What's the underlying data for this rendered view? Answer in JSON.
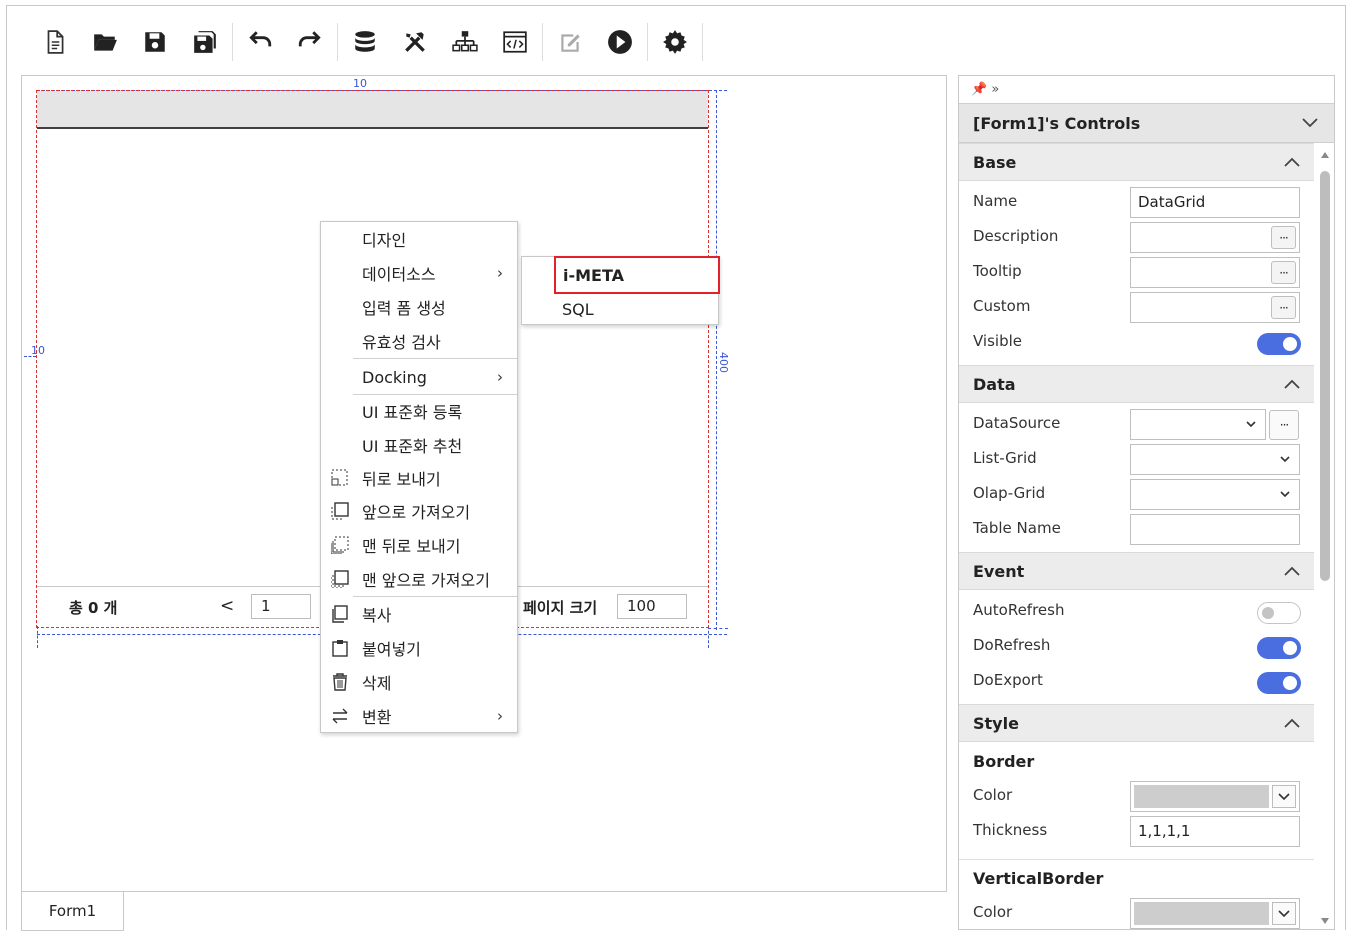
{
  "toolbar": {
    "icons": [
      "new-file-icon",
      "open-folder-icon",
      "save-icon",
      "save-all-icon",
      "undo-icon",
      "redo-icon",
      "database-icon",
      "tools-icon",
      "hierarchy-icon",
      "code-view-icon",
      "edit-icon",
      "run-icon",
      "settings-icon"
    ]
  },
  "designer": {
    "ruler_top": "10",
    "ruler_left": "10",
    "ruler_right": "400",
    "form_tab": "Form1",
    "grid_footer": {
      "total_label": "총  0 개",
      "prev": "<",
      "page_value": "1",
      "page_size_label": "페이지 크기",
      "page_size_value": "100"
    }
  },
  "context_menu": {
    "items": [
      {
        "label": "디자인",
        "arrow": ""
      },
      {
        "label": "데이터소스",
        "arrow": "›"
      },
      {
        "label": "입력 폼 생성",
        "arrow": ""
      },
      {
        "label": "유효성 검사",
        "arrow": ""
      },
      {
        "label": "Docking",
        "arrow": "›"
      },
      {
        "label": "UI 표준화 등록",
        "arrow": ""
      },
      {
        "label": "UI 표준화 추천",
        "arrow": ""
      },
      {
        "label": "뒤로 보내기",
        "arrow": ""
      },
      {
        "label": "앞으로 가져오기",
        "arrow": ""
      },
      {
        "label": "맨 뒤로 보내기",
        "arrow": ""
      },
      {
        "label": "맨 앞으로 가져오기",
        "arrow": ""
      },
      {
        "label": "복사",
        "arrow": ""
      },
      {
        "label": "붙여넣기",
        "arrow": ""
      },
      {
        "label": "삭제",
        "arrow": ""
      },
      {
        "label": "변환",
        "arrow": "›"
      }
    ],
    "submenu": [
      "i-META",
      "SQL"
    ]
  },
  "panel": {
    "top_icons": "📌 »",
    "title": "[Form1]'s Controls",
    "sections": {
      "base": "Base",
      "data": "Data",
      "event": "Event",
      "style": "Style"
    },
    "base": {
      "name_label": "Name",
      "name_value": "DataGrid",
      "description_label": "Description",
      "tooltip_label": "Tooltip",
      "custom_label": "Custom",
      "visible_label": "Visible"
    },
    "data": {
      "datasource_label": "DataSource",
      "listgrid_label": "List-Grid",
      "olapgrid_label": "Olap-Grid",
      "tablename_label": "Table Name"
    },
    "event": {
      "autorefresh_label": "AutoRefresh",
      "dorefresh_label": "DoRefresh",
      "doexport_label": "DoExport"
    },
    "style": {
      "border_head": "Border",
      "color_label": "Color",
      "thickness_label": "Thickness",
      "thickness_value": "1,1,1,1",
      "vborder_head": "VerticalBorder",
      "vcolor_label": "Color"
    },
    "dots": "···",
    "toggles": {
      "visible": true,
      "autorefresh": false,
      "dorefresh": true,
      "doexport": true
    },
    "accent_color": "#4a6ee0",
    "highlight_color": "#e4202c"
  }
}
